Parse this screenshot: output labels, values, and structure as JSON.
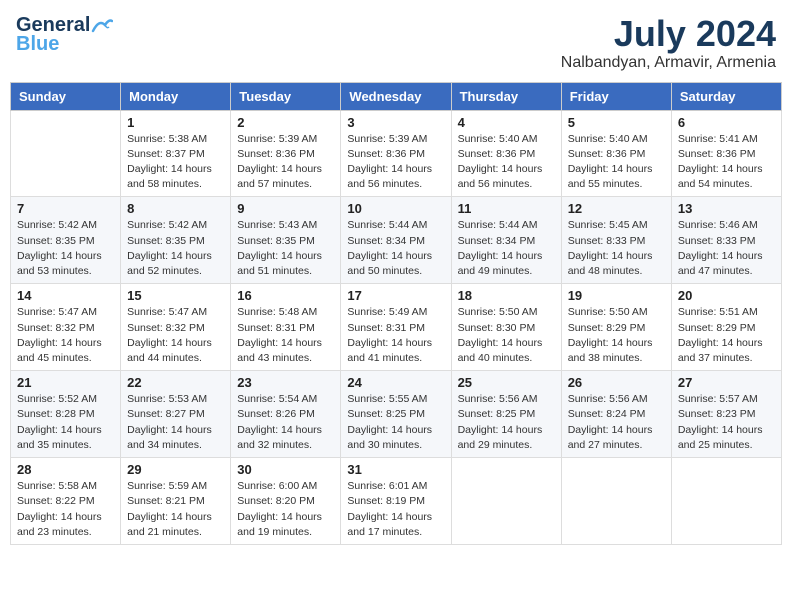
{
  "header": {
    "logo_general": "General",
    "logo_blue": "Blue",
    "month": "July 2024",
    "location": "Nalbandyan, Armavir, Armenia"
  },
  "weekdays": [
    "Sunday",
    "Monday",
    "Tuesday",
    "Wednesday",
    "Thursday",
    "Friday",
    "Saturday"
  ],
  "weeks": [
    [
      {
        "day": "",
        "sunrise": "",
        "sunset": "",
        "daylight": ""
      },
      {
        "day": "1",
        "sunrise": "Sunrise: 5:38 AM",
        "sunset": "Sunset: 8:37 PM",
        "daylight": "Daylight: 14 hours and 58 minutes."
      },
      {
        "day": "2",
        "sunrise": "Sunrise: 5:39 AM",
        "sunset": "Sunset: 8:36 PM",
        "daylight": "Daylight: 14 hours and 57 minutes."
      },
      {
        "day": "3",
        "sunrise": "Sunrise: 5:39 AM",
        "sunset": "Sunset: 8:36 PM",
        "daylight": "Daylight: 14 hours and 56 minutes."
      },
      {
        "day": "4",
        "sunrise": "Sunrise: 5:40 AM",
        "sunset": "Sunset: 8:36 PM",
        "daylight": "Daylight: 14 hours and 56 minutes."
      },
      {
        "day": "5",
        "sunrise": "Sunrise: 5:40 AM",
        "sunset": "Sunset: 8:36 PM",
        "daylight": "Daylight: 14 hours and 55 minutes."
      },
      {
        "day": "6",
        "sunrise": "Sunrise: 5:41 AM",
        "sunset": "Sunset: 8:36 PM",
        "daylight": "Daylight: 14 hours and 54 minutes."
      }
    ],
    [
      {
        "day": "7",
        "sunrise": "Sunrise: 5:42 AM",
        "sunset": "Sunset: 8:35 PM",
        "daylight": "Daylight: 14 hours and 53 minutes."
      },
      {
        "day": "8",
        "sunrise": "Sunrise: 5:42 AM",
        "sunset": "Sunset: 8:35 PM",
        "daylight": "Daylight: 14 hours and 52 minutes."
      },
      {
        "day": "9",
        "sunrise": "Sunrise: 5:43 AM",
        "sunset": "Sunset: 8:35 PM",
        "daylight": "Daylight: 14 hours and 51 minutes."
      },
      {
        "day": "10",
        "sunrise": "Sunrise: 5:44 AM",
        "sunset": "Sunset: 8:34 PM",
        "daylight": "Daylight: 14 hours and 50 minutes."
      },
      {
        "day": "11",
        "sunrise": "Sunrise: 5:44 AM",
        "sunset": "Sunset: 8:34 PM",
        "daylight": "Daylight: 14 hours and 49 minutes."
      },
      {
        "day": "12",
        "sunrise": "Sunrise: 5:45 AM",
        "sunset": "Sunset: 8:33 PM",
        "daylight": "Daylight: 14 hours and 48 minutes."
      },
      {
        "day": "13",
        "sunrise": "Sunrise: 5:46 AM",
        "sunset": "Sunset: 8:33 PM",
        "daylight": "Daylight: 14 hours and 47 minutes."
      }
    ],
    [
      {
        "day": "14",
        "sunrise": "Sunrise: 5:47 AM",
        "sunset": "Sunset: 8:32 PM",
        "daylight": "Daylight: 14 hours and 45 minutes."
      },
      {
        "day": "15",
        "sunrise": "Sunrise: 5:47 AM",
        "sunset": "Sunset: 8:32 PM",
        "daylight": "Daylight: 14 hours and 44 minutes."
      },
      {
        "day": "16",
        "sunrise": "Sunrise: 5:48 AM",
        "sunset": "Sunset: 8:31 PM",
        "daylight": "Daylight: 14 hours and 43 minutes."
      },
      {
        "day": "17",
        "sunrise": "Sunrise: 5:49 AM",
        "sunset": "Sunset: 8:31 PM",
        "daylight": "Daylight: 14 hours and 41 minutes."
      },
      {
        "day": "18",
        "sunrise": "Sunrise: 5:50 AM",
        "sunset": "Sunset: 8:30 PM",
        "daylight": "Daylight: 14 hours and 40 minutes."
      },
      {
        "day": "19",
        "sunrise": "Sunrise: 5:50 AM",
        "sunset": "Sunset: 8:29 PM",
        "daylight": "Daylight: 14 hours and 38 minutes."
      },
      {
        "day": "20",
        "sunrise": "Sunrise: 5:51 AM",
        "sunset": "Sunset: 8:29 PM",
        "daylight": "Daylight: 14 hours and 37 minutes."
      }
    ],
    [
      {
        "day": "21",
        "sunrise": "Sunrise: 5:52 AM",
        "sunset": "Sunset: 8:28 PM",
        "daylight": "Daylight: 14 hours and 35 minutes."
      },
      {
        "day": "22",
        "sunrise": "Sunrise: 5:53 AM",
        "sunset": "Sunset: 8:27 PM",
        "daylight": "Daylight: 14 hours and 34 minutes."
      },
      {
        "day": "23",
        "sunrise": "Sunrise: 5:54 AM",
        "sunset": "Sunset: 8:26 PM",
        "daylight": "Daylight: 14 hours and 32 minutes."
      },
      {
        "day": "24",
        "sunrise": "Sunrise: 5:55 AM",
        "sunset": "Sunset: 8:25 PM",
        "daylight": "Daylight: 14 hours and 30 minutes."
      },
      {
        "day": "25",
        "sunrise": "Sunrise: 5:56 AM",
        "sunset": "Sunset: 8:25 PM",
        "daylight": "Daylight: 14 hours and 29 minutes."
      },
      {
        "day": "26",
        "sunrise": "Sunrise: 5:56 AM",
        "sunset": "Sunset: 8:24 PM",
        "daylight": "Daylight: 14 hours and 27 minutes."
      },
      {
        "day": "27",
        "sunrise": "Sunrise: 5:57 AM",
        "sunset": "Sunset: 8:23 PM",
        "daylight": "Daylight: 14 hours and 25 minutes."
      }
    ],
    [
      {
        "day": "28",
        "sunrise": "Sunrise: 5:58 AM",
        "sunset": "Sunset: 8:22 PM",
        "daylight": "Daylight: 14 hours and 23 minutes."
      },
      {
        "day": "29",
        "sunrise": "Sunrise: 5:59 AM",
        "sunset": "Sunset: 8:21 PM",
        "daylight": "Daylight: 14 hours and 21 minutes."
      },
      {
        "day": "30",
        "sunrise": "Sunrise: 6:00 AM",
        "sunset": "Sunset: 8:20 PM",
        "daylight": "Daylight: 14 hours and 19 minutes."
      },
      {
        "day": "31",
        "sunrise": "Sunrise: 6:01 AM",
        "sunset": "Sunset: 8:19 PM",
        "daylight": "Daylight: 14 hours and 17 minutes."
      },
      {
        "day": "",
        "sunrise": "",
        "sunset": "",
        "daylight": ""
      },
      {
        "day": "",
        "sunrise": "",
        "sunset": "",
        "daylight": ""
      },
      {
        "day": "",
        "sunrise": "",
        "sunset": "",
        "daylight": ""
      }
    ]
  ]
}
